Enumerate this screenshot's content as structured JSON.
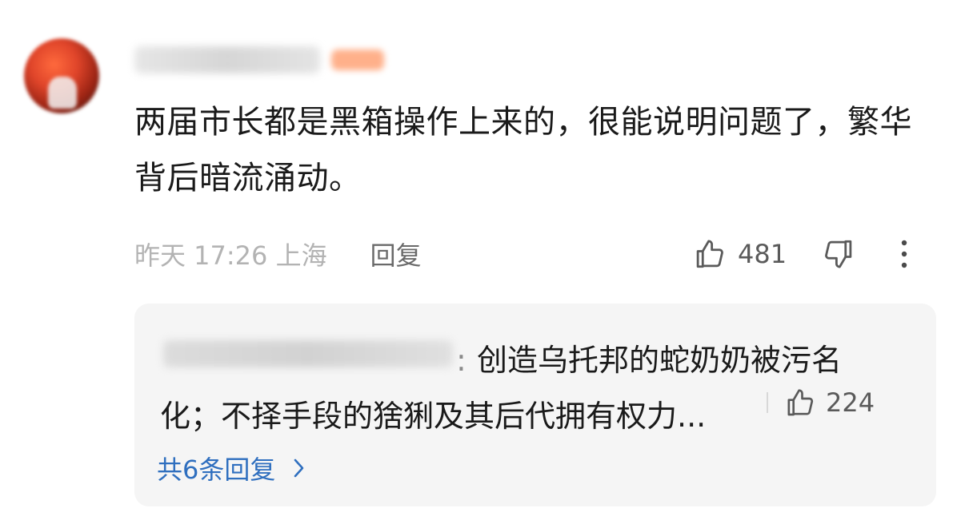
{
  "comment": {
    "text": "两届市长都是黑箱操作上来的，很能说明问题了，繁华背后暗流涌动。",
    "time_location": "昨天 17:26 上海",
    "reply_label": "回复",
    "like_count": "481"
  },
  "reply_preview": {
    "colon": ":",
    "text": "创造乌托邦的蛇奶奶被污名化；不择手段的猞猁及其后代拥有权力...",
    "like_count": "224",
    "view_all_label": "共6条回复"
  },
  "icons": {
    "like": "thumbs-up-icon",
    "dislike": "thumbs-down-icon",
    "more": "more-vertical-icon",
    "chevron": "chevron-right-icon"
  },
  "colors": {
    "link_blue": "#2f6fbf",
    "muted_text": "#b3b3b3",
    "reply_bg": "#f5f5f5"
  }
}
